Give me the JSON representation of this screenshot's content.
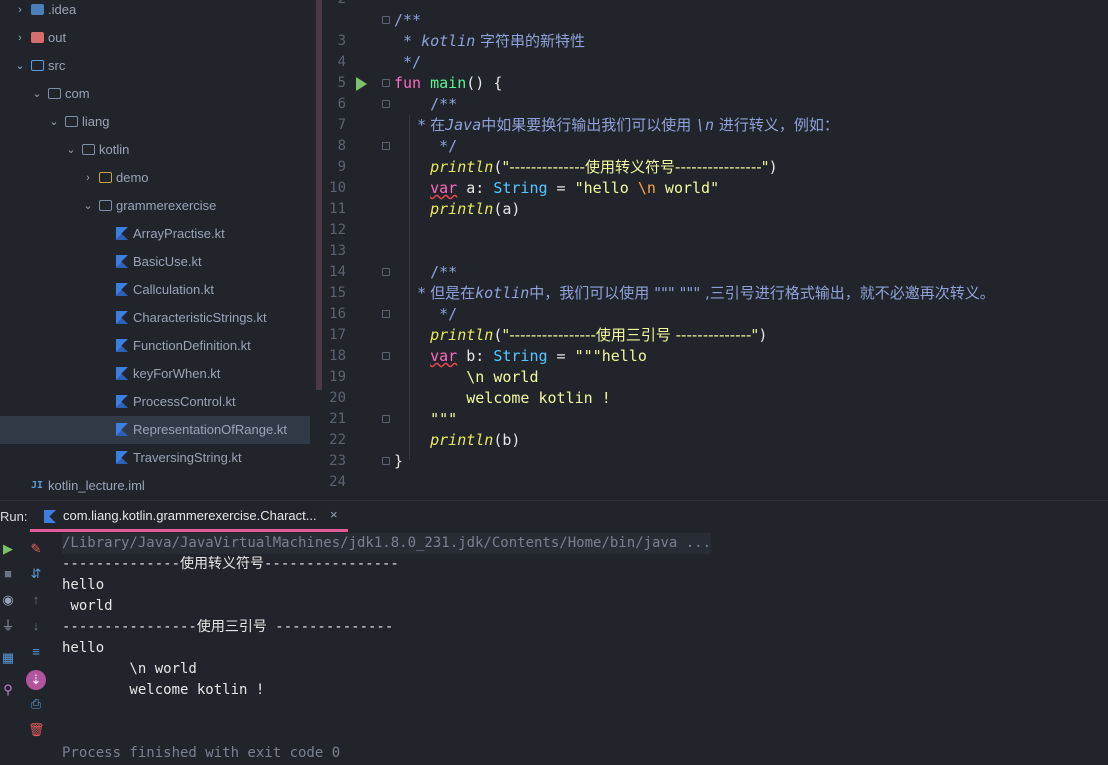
{
  "tree": {
    "items": [
      {
        "label": ".idea",
        "chevron": "›",
        "icon": "folder-idea-icon"
      },
      {
        "label": "out",
        "chevron": "›",
        "icon": "folder-out-icon"
      },
      {
        "label": "src",
        "chevron": "⌄",
        "icon": "folder-src-icon"
      },
      {
        "label": "com",
        "chevron": "⌄",
        "icon": "folder-icon"
      },
      {
        "label": "liang",
        "chevron": "⌄",
        "icon": "folder-icon"
      },
      {
        "label": "kotlin",
        "chevron": "⌄",
        "icon": "folder-icon"
      },
      {
        "label": "demo",
        "chevron": "›",
        "icon": "folder-demo-icon"
      },
      {
        "label": "grammerexercise",
        "chevron": "⌄",
        "icon": "folder-icon"
      },
      {
        "label": "ArrayPractise.kt",
        "icon": "kotlin-file-icon"
      },
      {
        "label": "BasicUse.kt",
        "icon": "kotlin-file-icon"
      },
      {
        "label": "Callculation.kt",
        "icon": "kotlin-file-icon"
      },
      {
        "label": "CharacteristicStrings.kt",
        "icon": "kotlin-file-icon"
      },
      {
        "label": "FunctionDefinition.kt",
        "icon": "kotlin-file-icon"
      },
      {
        "label": "keyForWhen.kt",
        "icon": "kotlin-file-icon"
      },
      {
        "label": "ProcessControl.kt",
        "icon": "kotlin-file-icon"
      },
      {
        "label": "RepresentationOfRange.kt",
        "icon": "kotlin-file-icon",
        "selected": true
      },
      {
        "label": "TraversingString.kt",
        "icon": "kotlin-file-icon"
      },
      {
        "label": "kotlin_lecture.iml",
        "icon": "iml-file-icon"
      }
    ]
  },
  "editor": {
    "line_numbers": [
      "2",
      "3",
      "4",
      "5",
      "6",
      "7",
      "8",
      "9",
      "10",
      "11",
      "12",
      "13",
      "14",
      "15",
      "16",
      "17",
      "18",
      "19",
      "20",
      "21",
      "22",
      "23",
      "24"
    ],
    "code": {
      "l3": "/**",
      "l4_star": " * ",
      "l4_kw": "kotlin",
      "l4_text": " 字符串的新特性",
      "l5": " */",
      "l6_fun": "fun",
      "l6_main": "main",
      "l6_rest": "() {",
      "l7": "    /**",
      "l8_a": "     * 在",
      "l8_java": "Java",
      "l8_b": "中如果要换行输出我们可以使用 ",
      "l8_n": "\\n",
      "l8_c": " 进行转义，例如：",
      "l9": "     */",
      "l10_fn": "println",
      "l10_p1": "(",
      "l10_str": "\"--------------使用转义符号----------------\"",
      "l10_p2": ")",
      "l11_var": "var",
      "l11_name": " a: ",
      "l11_type": "String",
      "l11_eq": " = ",
      "l11_s1": "\"hello ",
      "l11_esc": "\\n",
      "l11_s2": " world\"",
      "l12_fn": "println",
      "l12_rest": "(a)",
      "l15": "    /**",
      "l16_a": "     * 但是在",
      "l16_k": "kotlin",
      "l16_b": "中，我们可以使用 \"\"\" \"\"\" ,三引号进行格式输出，就不必邀再次转义。",
      "l17": "     */",
      "l18_fn": "println",
      "l18_p1": "(",
      "l18_str": "\"----------------使用三引号 --------------\"",
      "l18_p2": ")",
      "l19_var": "var",
      "l19_name": " b: ",
      "l19_type": "String",
      "l19_eq": " = ",
      "l19_str": "\"\"\"hello",
      "l20": "        \\n world",
      "l21": "        welcome kotlin !",
      "l22": "    \"\"\"",
      "l23_fn": "println",
      "l23_rest": "(b)",
      "l24": "}"
    }
  },
  "run": {
    "label": "Run:",
    "tab_label": "com.liang.kotlin.grammerexercise.Charact...",
    "close": "×",
    "output": [
      "/Library/Java/JavaVirtualMachines/jdk1.8.0_231.jdk/Contents/Home/bin/java ...",
      "--------------使用转义符号----------------",
      "hello",
      " world",
      "----------------使用三引号 --------------",
      "hello",
      "        \\n world",
      "        welcome kotlin !",
      "",
      "Process finished with exit code 0"
    ]
  },
  "colors": {
    "background": "#21252b",
    "selection": "#333a47",
    "keyword": "#ff6ac1",
    "function": "#5af78e",
    "type": "#57c7ff",
    "string": "#f3f99d",
    "comment": "#8fa1d8",
    "run_tab_accent": "#e45b9a"
  }
}
